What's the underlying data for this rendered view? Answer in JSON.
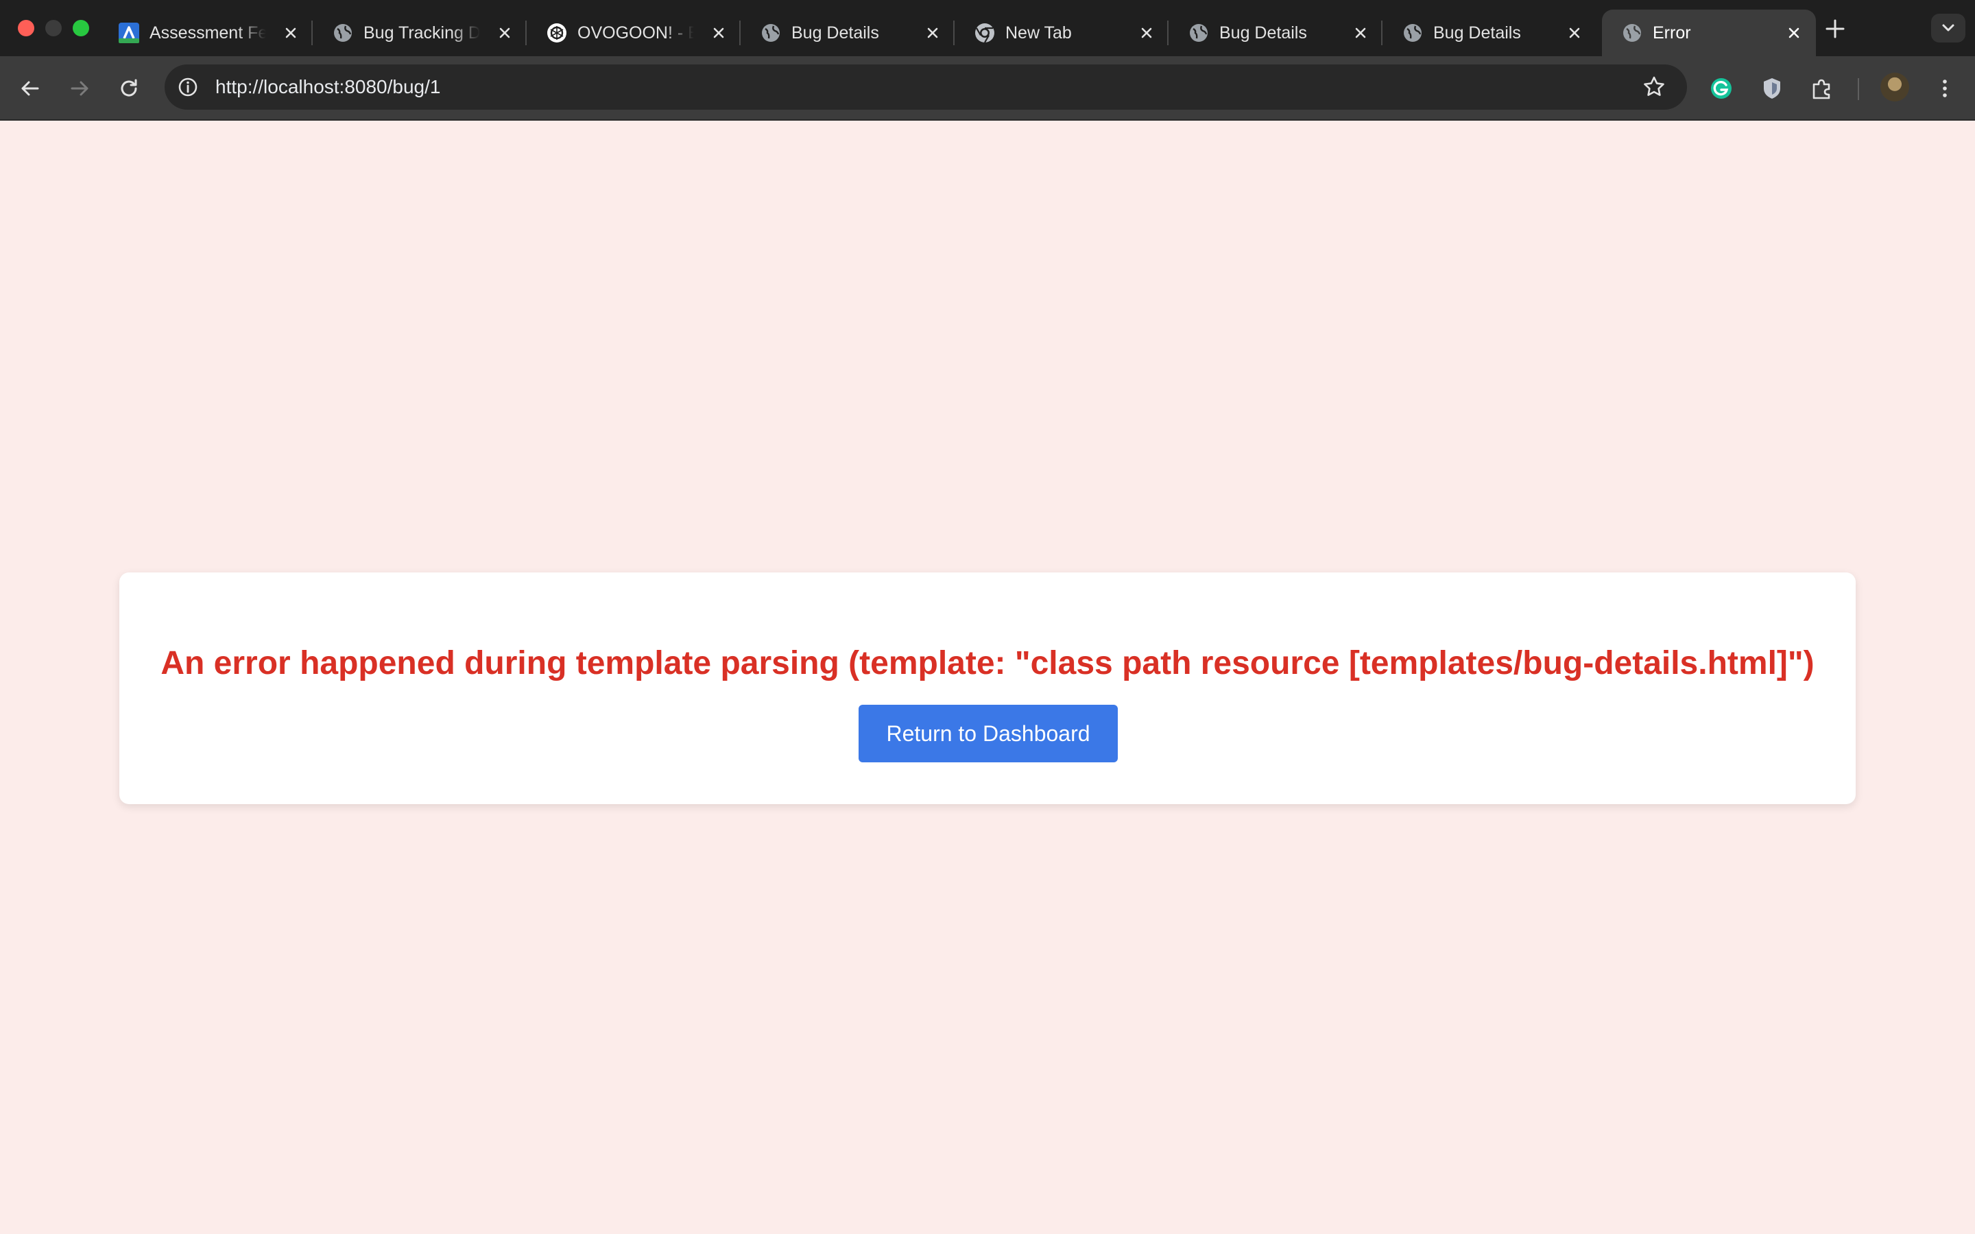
{
  "browser": {
    "tabs": [
      {
        "title": "Assessment Fe",
        "favicon": "app-logo-icon",
        "active": false
      },
      {
        "title": "Bug Tracking D",
        "favicon": "globe-icon",
        "active": false
      },
      {
        "title": "OVOGOON! - E",
        "favicon": "openai-icon",
        "active": false
      },
      {
        "title": "Bug Details",
        "favicon": "globe-icon",
        "active": false
      },
      {
        "title": "New Tab",
        "favicon": "chrome-icon",
        "active": false
      },
      {
        "title": "Bug Details",
        "favicon": "globe-icon",
        "active": false
      },
      {
        "title": "Bug Details",
        "favicon": "globe-icon",
        "active": false
      },
      {
        "title": "Error",
        "favicon": "globe-icon",
        "active": true
      }
    ],
    "address_bar": {
      "url": "http://localhost:8080/bug/1"
    },
    "colors": {
      "tab_strip": "#1f1f1f",
      "toolbar": "#3c3c3c",
      "omnibox": "#282828"
    }
  },
  "page": {
    "error_message": "An error happened during template parsing (template: \"class path resource [templates/bug-details.html]\")",
    "return_button_label": "Return to Dashboard",
    "colors": {
      "background": "#fcecea",
      "error_text": "#d93025",
      "button": "#3b78e7"
    }
  }
}
